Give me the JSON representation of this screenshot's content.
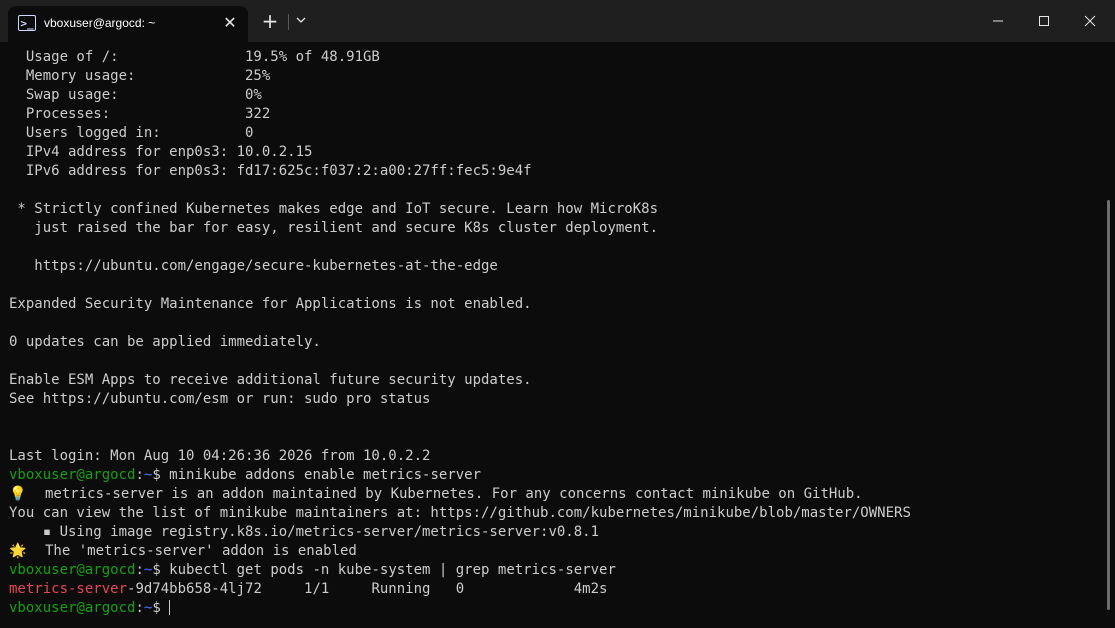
{
  "window": {
    "tab_title": "vboxuser@argocd: ~",
    "tab_icon_glyph": ">_",
    "close_tab_glyph": "✕",
    "new_tab_glyph": "+"
  },
  "colors": {
    "background": "#0c0c0c",
    "titlebar": "#1f1f1f",
    "text": "#cccccc",
    "prompt_user": "#13a10e",
    "prompt_path": "#3b78ff",
    "highlight": "#e74856"
  },
  "terminal": {
    "sysinfo": [
      "  Usage of /:               19.5% of 48.91GB",
      "  Memory usage:             25%",
      "  Swap usage:               0%",
      "  Processes:                322",
      "  Users logged in:          0",
      "  IPv4 address for enp0s3: 10.0.2.15",
      "  IPv6 address for enp0s3: fd17:625c:f037:2:a00:27ff:fec5:9e4f"
    ],
    "motd": [
      " * Strictly confined Kubernetes makes edge and IoT secure. Learn how MicroK8s",
      "   just raised the bar for easy, resilient and secure K8s cluster deployment.",
      "   https://ubuntu.com/engage/secure-kubernetes-at-the-edge",
      "Expanded Security Maintenance for Applications is not enabled.",
      "0 updates can be applied immediately.",
      "Enable ESM Apps to receive additional future security updates.",
      "See https://ubuntu.com/esm or run: sudo pro status",
      "Last login: Mon Aug 10 04:26:36 2026 from 10.0.2.2"
    ],
    "prompt": {
      "user_host": "vboxuser@argocd",
      "colon": ":",
      "path": "~",
      "symbol": "$ "
    },
    "commands": [
      "minikube addons enable metrics-server",
      "kubectl get pods -n kube-system | grep metrics-server"
    ],
    "addon_output": {
      "bulb_icon": "💡",
      "info": "metrics-server is an addon maintained by Kubernetes. For any concerns contact minikube on GitHub.",
      "maintainers": "You can view the list of minikube maintainers at: https://github.com/kubernetes/minikube/blob/master/OWNERS",
      "image": "    ▪ Using image registry.k8s.io/metrics-server/metrics-server:v0.8.1",
      "star_icon": "🌟",
      "enabled": "The 'metrics-server' addon is enabled"
    },
    "pod_row": {
      "match": "metrics-server",
      "rest": "-9d74bb658-4lj72     1/1     Running   0             4m2s"
    }
  }
}
